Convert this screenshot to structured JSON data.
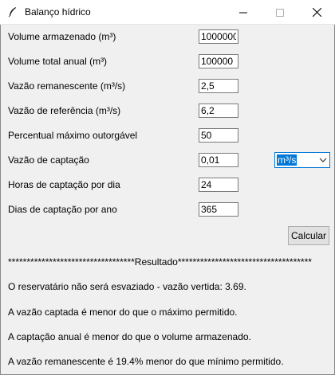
{
  "window": {
    "title": "Balanço hídrico"
  },
  "form": {
    "rows": [
      {
        "label": "Volume armazenado (m³)",
        "value": "1000000"
      },
      {
        "label": "Volume total anual (m³)",
        "value": "100000"
      },
      {
        "label": "Vazão remanescente (m³/s)",
        "value": "2,5"
      },
      {
        "label": "Vazão de referência (m³/s)",
        "value": "6,2"
      },
      {
        "label": "Percentual máximo outorgável",
        "value": "50"
      },
      {
        "label": "Vazão de captação",
        "value": "0,01"
      },
      {
        "label": "Horas de captação por dia",
        "value": "24"
      },
      {
        "label": "Dias de captação por ano",
        "value": "365"
      }
    ],
    "unit_select": {
      "selected": "m³/s"
    },
    "calculate_label": "Calcular"
  },
  "result": {
    "header": "**********************************Resultado************************************",
    "lines": [
      "O reservatário não será esvaziado - vazão vertida: 3.69.",
      "A vazão captada é menor do que o máximo permitido.",
      "A captação anual é menor do que o volume armazenado.",
      "A vazão remanescente é 19.4% menor do que mínimo permitido."
    ]
  },
  "colors": {
    "background": "#f0f0f0",
    "accent": "#0078d7"
  }
}
